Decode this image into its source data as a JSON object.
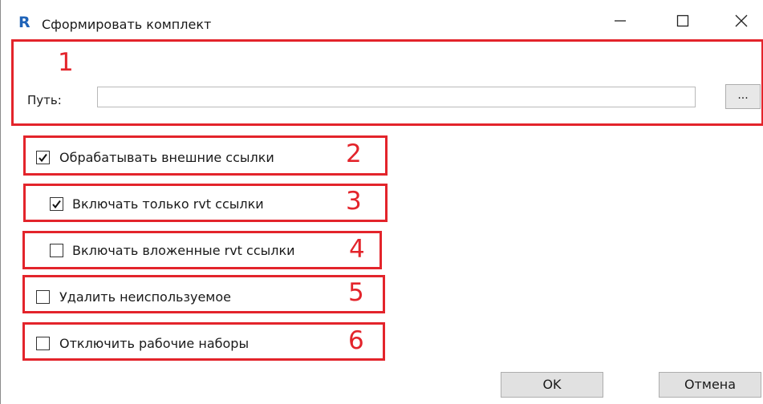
{
  "window": {
    "title": "Сформировать комплект",
    "app_icon_letter": "R"
  },
  "path": {
    "label": "Путь:",
    "value": "",
    "browse_label": "..."
  },
  "options": [
    {
      "label": "Обрабатывать внешние ссылки",
      "checked": true
    },
    {
      "label": "Включать только rvt ссылки",
      "checked": true
    },
    {
      "label": "Включать вложенные rvt ссылки",
      "checked": false
    },
    {
      "label": "Удалить неиспользуемое",
      "checked": false
    },
    {
      "label": "Отключить рабочие наборы",
      "checked": false
    }
  ],
  "annotations": [
    "1",
    "2",
    "3",
    "4",
    "5",
    "6"
  ],
  "buttons": {
    "ok": "OK",
    "cancel": "Отмена"
  },
  "colors": {
    "annotation_red": "#e3242b",
    "app_icon_blue": "#1f63b8"
  }
}
